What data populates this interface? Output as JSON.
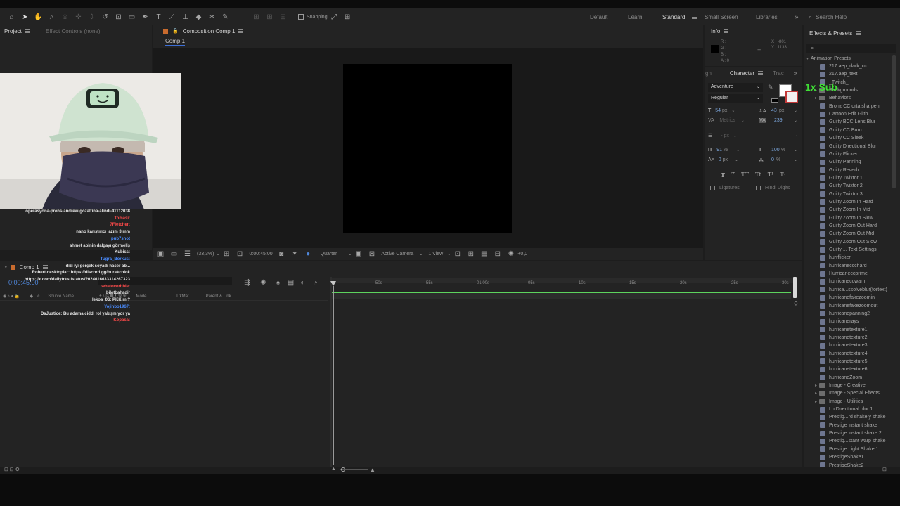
{
  "workspaces": {
    "default": "Default",
    "learn": "Learn",
    "standard": "Standard",
    "small_screen": "Small Screen",
    "libraries": "Libraries"
  },
  "toolbar": {
    "snapping": "Snapping",
    "search_help": "Search Help"
  },
  "project_panel": {
    "tab_project": "Project",
    "tab_effect_controls": "Effect Controls (none)"
  },
  "composition_panel": {
    "tab": "Composition Comp 1",
    "subtab": "Comp 1",
    "zoom": "(33,3%)",
    "timecode": "0:00:45:00",
    "resolution": "Quarter",
    "camera": "Active Camera",
    "views": "1 View",
    "exposure": "+0,0"
  },
  "info": {
    "title": "Info",
    "r": "R :",
    "g": "G :",
    "b": "B :",
    "a": "A : 0",
    "x": "X : -801",
    "y": "Y : 1133"
  },
  "character": {
    "tab_left": "gn",
    "title": "Character",
    "tab_right": "Trac",
    "font": "Adventure",
    "style": "Regular",
    "size": "54",
    "size_unit": "px",
    "leading": "43",
    "leading_unit": "px",
    "kerning": "Metrics",
    "tracking": "239",
    "stroke": "- px",
    "vscale": "91",
    "vscale_unit": "%",
    "hscale": "100",
    "hscale_unit": "%",
    "baseline": "0",
    "baseline_unit": "px",
    "tsume": "0",
    "tsume_unit": "%",
    "ligatures": "Ligatures",
    "hindi_digits": "Hindi Digits",
    "type_buttons": [
      "T",
      "T",
      "TT",
      "Tt",
      "T¹",
      "T₁"
    ]
  },
  "effects": {
    "title": "Effects & Presets",
    "search_placeholder": "",
    "root": "Animation Presets",
    "items": [
      {
        "t": "item",
        "label": "217.aep_dark_cc"
      },
      {
        "t": "item",
        "label": "217.aep_text"
      },
      {
        "t": "item",
        "label": "_Twitch_"
      },
      {
        "t": "folder",
        "label": "Backgrounds"
      },
      {
        "t": "folder",
        "label": "Behaviors"
      },
      {
        "t": "item",
        "label": "Bronz CC orta sharpen"
      },
      {
        "t": "item",
        "label": "Cartoon Edit Glith"
      },
      {
        "t": "item",
        "label": "Guilty BCC Lens Blur"
      },
      {
        "t": "item",
        "label": "Guilty CC Burn"
      },
      {
        "t": "item",
        "label": "Guilty CC Sleek"
      },
      {
        "t": "item",
        "label": "Guilty Directional Blur"
      },
      {
        "t": "item",
        "label": "Guilty Flicker"
      },
      {
        "t": "item",
        "label": "Guilty Panning"
      },
      {
        "t": "item",
        "label": "Guilty Reverb"
      },
      {
        "t": "item",
        "label": "Guilty Twixtor 1"
      },
      {
        "t": "item",
        "label": "Guilty Twixtor 2"
      },
      {
        "t": "item",
        "label": "Guilty Twixtor 3"
      },
      {
        "t": "item",
        "label": "Guilty Zoom In Hard"
      },
      {
        "t": "item",
        "label": "Guilty Zoom In Mid"
      },
      {
        "t": "item",
        "label": "Guilty Zoom In Slow"
      },
      {
        "t": "item",
        "label": "Guilty Zoom Out Hard"
      },
      {
        "t": "item",
        "label": "Guilty Zoom Out Mid"
      },
      {
        "t": "item",
        "label": "Guilty Zoom Out Slow"
      },
      {
        "t": "item",
        "label": "Guilty ... Text Settings"
      },
      {
        "t": "item",
        "label": "hurrflicker"
      },
      {
        "t": "item",
        "label": "hurricaneccchard"
      },
      {
        "t": "item",
        "label": "Hurricaneccprime"
      },
      {
        "t": "item",
        "label": "hurricaneccwarm"
      },
      {
        "t": "item",
        "label": "hurrica...ssolveblur(fortext)"
      },
      {
        "t": "item",
        "label": "hurricanefakezoomin"
      },
      {
        "t": "item",
        "label": "hurricanefakezoomout"
      },
      {
        "t": "item",
        "label": "hurricanepanning2"
      },
      {
        "t": "item",
        "label": "hurricanerays"
      },
      {
        "t": "item",
        "label": "hurricanetexture1"
      },
      {
        "t": "item",
        "label": "hurricanetexture2"
      },
      {
        "t": "item",
        "label": "hurricanetexture3"
      },
      {
        "t": "item",
        "label": "hurricanetexture4"
      },
      {
        "t": "item",
        "label": "hurricanetexture5"
      },
      {
        "t": "item",
        "label": "hurricanetexture6"
      },
      {
        "t": "item",
        "label": "hurricaneZoom"
      },
      {
        "t": "folder",
        "label": "Image - Creative"
      },
      {
        "t": "folder",
        "label": "Image - Special Effects"
      },
      {
        "t": "folder",
        "label": "Image - Utilities"
      },
      {
        "t": "item",
        "label": "Lo Directional blur 1"
      },
      {
        "t": "item",
        "label": "Prestig...rd shake y shake"
      },
      {
        "t": "item",
        "label": "Prestige instant shake"
      },
      {
        "t": "item",
        "label": "Prestige instant shake 2"
      },
      {
        "t": "item",
        "label": "Prestig...stant warp shake"
      },
      {
        "t": "item",
        "label": "Prestige Light Shake 1"
      },
      {
        "t": "item",
        "label": "PrestigeShake1"
      },
      {
        "t": "item",
        "label": "PrestigeShake2"
      }
    ]
  },
  "timeline": {
    "tab": "Comp 1",
    "timecode": "0:00:45:00",
    "col_source": "Source Name",
    "col_mode": "Mode",
    "col_t": "T",
    "col_trkmat": "TrkMat",
    "col_parent": "Parent & Link",
    "ruler": [
      "50s",
      "55s",
      "01:00s",
      "05s",
      "10s",
      "15s",
      "20s",
      "25s",
      "30s"
    ]
  },
  "overlay": {
    "sub_text": "1x Sub",
    "chat": [
      {
        "text": "operasyona-prens-andrew-gozaltina-alindi-41112038",
        "color": "#e6e6e6"
      },
      {
        "text": "Tomasi:",
        "color": "#ff4a4a"
      },
      {
        "text": "7Fletcher:",
        "color": "#ff4a4a"
      },
      {
        "text": "nano karıştırıcı lazım 3 mm",
        "color": "#e6e6e6"
      },
      {
        "text": "pub7shot",
        "color": "#4a8cff"
      },
      {
        "text": "ahmet abinin dalgayı görmeliş",
        "color": "#e6e6e6"
      },
      {
        "text": "Kubiss:",
        "color": "#e6e6e6"
      },
      {
        "text": "Tugra_Borkus:",
        "color": "#4a8cff"
      },
      {
        "text": "dizi iyi gerçek soyadı hacer ab...",
        "color": "#e6e6e6"
      },
      {
        "text": "Robert desktoplar: https://discord.gg/burakcolok",
        "color": "#e6e6e6"
      },
      {
        "text": "https://x.com/dallytrkst/status/2024616633314267323",
        "color": "#e6e6e6"
      },
      {
        "text": "whatoverbble:",
        "color": "#ff4a4a"
      },
      {
        "text": "biletbahadir",
        "color": "#e6e6e6"
      },
      {
        "text": "lekos_06: PKK mı?",
        "color": "#e6e6e6"
      },
      {
        "text": "Yojinbo1967:",
        "color": "#4a8cff"
      },
      {
        "text": "DaJustice: Bu adama ciddi rol yakışmıyor ya",
        "color": "#e6e6e6"
      },
      {
        "text": "Kopasa:",
        "color": "#ff4a4a"
      }
    ]
  }
}
